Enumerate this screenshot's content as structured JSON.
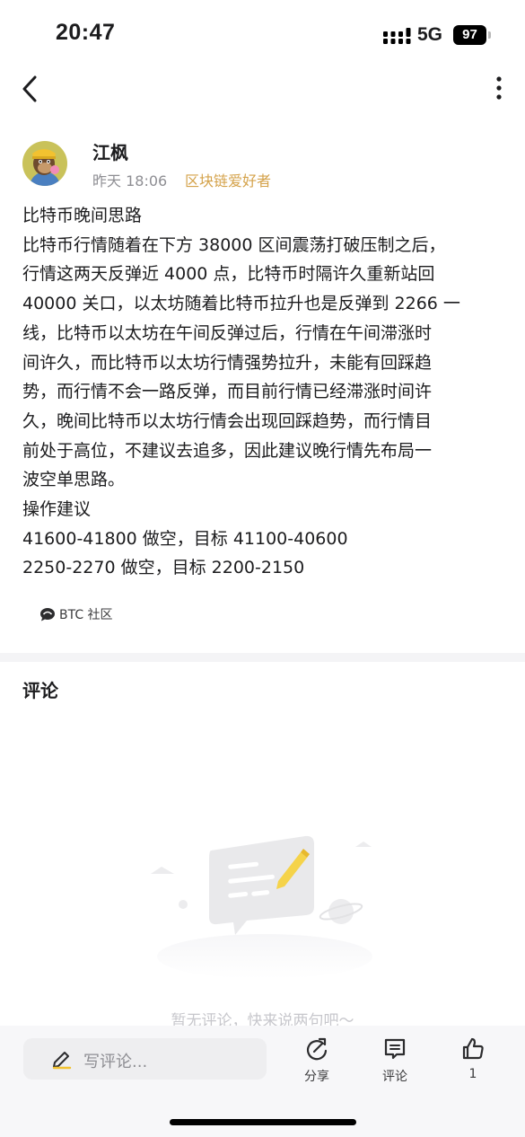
{
  "status_bar": {
    "time": "20:47",
    "network": "5G",
    "battery": "97"
  },
  "nav": {
    "back_icon": "chevron-left-icon",
    "more_icon": "more-vertical-icon"
  },
  "author": {
    "name": "江枫",
    "time": "昨天 18:06",
    "tag": "区块链爱好者",
    "tag_color": "#d4a24a"
  },
  "post": {
    "lines": [
      "比特币晚间思路",
      "比特币行情随着在下方 38000 区间震荡打破压制之后，",
      "行情这两天反弹近 4000 点，比特币时隔许久重新站回",
      "40000 关口，以太坊随着比特币拉升也是反弹到 2266 一",
      "线，比特币以太坊在午间反弹过后，行情在午间滞涨时",
      "间许久，而比特币以太坊行情强势拉升，未能有回踩趋",
      "势，而行情不会一路反弹，而目前行情已经滞涨时间许",
      "久，晚间比特币以太坊行情会出现回踩趋势，而行情目",
      "前处于高位，不建议去追多，因此建议晚行情先布局一",
      "波空单思路。",
      "操作建议",
      "41600-41800 做空，目标 41100-40600",
      "2250-2270 做空，目标 2200-2150"
    ]
  },
  "community": {
    "label": "BTC 社区"
  },
  "comments": {
    "title": "评论",
    "empty_text": "暂无评论，快来说两句吧～"
  },
  "bottom_bar": {
    "input_placeholder": "写评论...",
    "share_label": "分享",
    "comment_label": "评论",
    "like_count": "1"
  }
}
